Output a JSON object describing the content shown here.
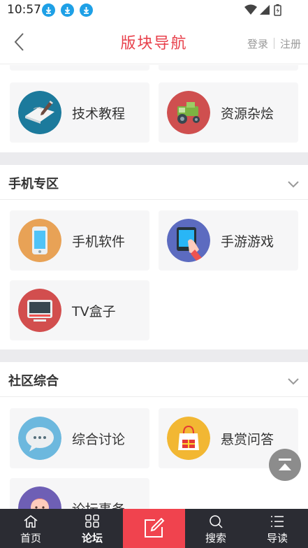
{
  "status_bar": {
    "time": "10:57",
    "accent": "#1ea0e6"
  },
  "header": {
    "title": "版块导航",
    "login": "登录",
    "register": "注册",
    "title_color": "#e8404b"
  },
  "sections": [
    {
      "cards": [
        {
          "label": "技术教程",
          "icon": "notebook-pen-icon"
        },
        {
          "label": "资源杂烩",
          "icon": "tractor-icon"
        }
      ]
    },
    {
      "title": "手机专区",
      "cards": [
        {
          "label": "手机软件",
          "icon": "smartphone-icon"
        },
        {
          "label": "手游游戏",
          "icon": "tablet-touch-icon"
        },
        {
          "label": "TV盒子",
          "icon": "tv-box-icon"
        }
      ]
    },
    {
      "title": "社区综合",
      "cards": [
        {
          "label": "综合讨论",
          "icon": "chat-bubble-icon"
        },
        {
          "label": "悬赏问答",
          "icon": "gift-bag-icon"
        },
        {
          "label": "论坛事务",
          "icon": "avatar-icon"
        }
      ]
    }
  ],
  "bottom_nav": {
    "items": [
      {
        "label": "首页",
        "icon": "home-icon"
      },
      {
        "label": "论坛",
        "icon": "grid-icon"
      },
      {
        "label": "",
        "icon": "compose-icon"
      },
      {
        "label": "搜索",
        "icon": "search-icon"
      },
      {
        "label": "导读",
        "icon": "list-icon"
      }
    ],
    "active": "论坛",
    "post_color": "#f0434e",
    "bg_color": "#2b2c33"
  }
}
